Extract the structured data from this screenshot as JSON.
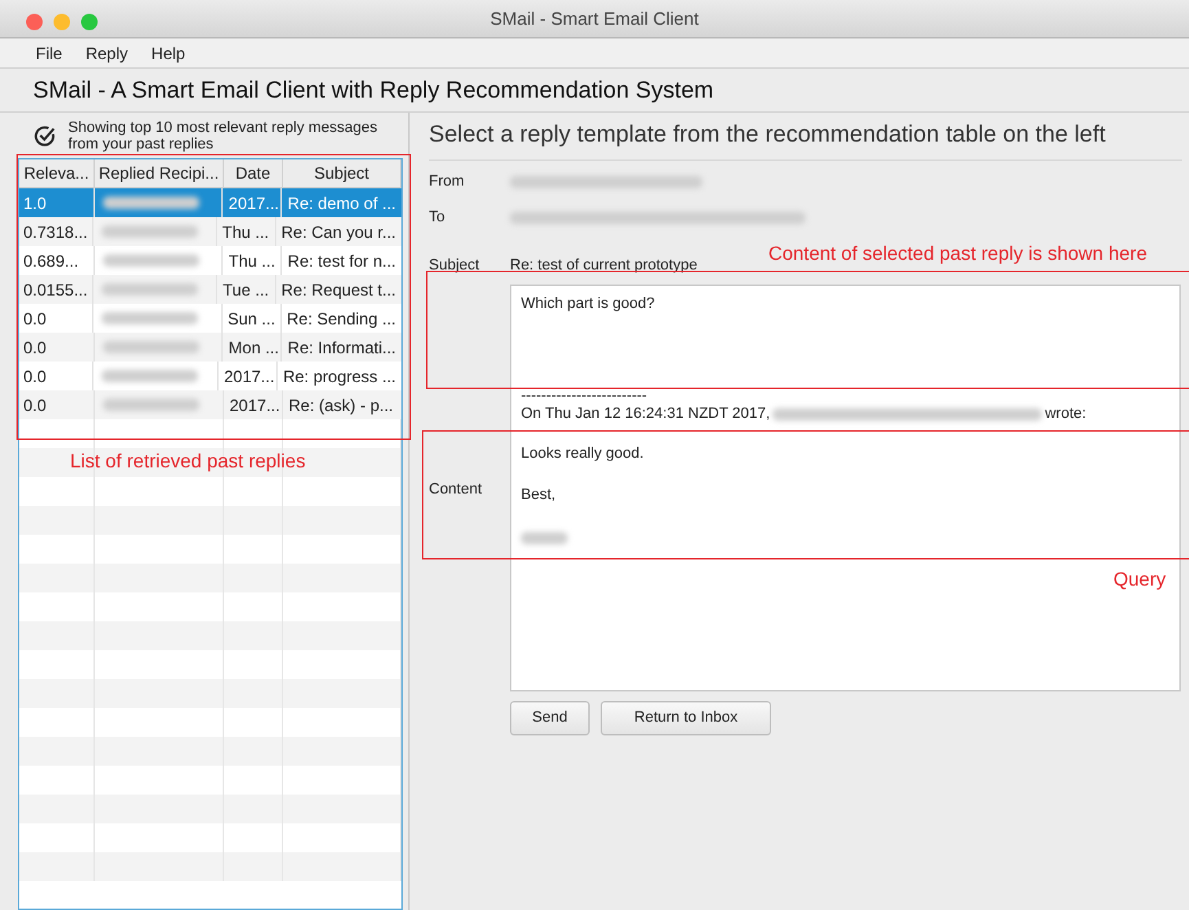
{
  "window": {
    "title": "SMail - Smart Email Client"
  },
  "menu": [
    "File",
    "Reply",
    "Help"
  ],
  "app_title": "SMail - A Smart Email Client with Reply Recommendation System",
  "left": {
    "notice": "Showing top 10 most relevant reply messages from your past replies",
    "table": {
      "columns": [
        "Releva...",
        "Replied Recipi...",
        "Date",
        "Subject"
      ],
      "rows": [
        {
          "relevance": "1.0",
          "date": "2017...",
          "subject": "Re: demo of ...",
          "selected": true
        },
        {
          "relevance": "0.7318...",
          "date": "Thu ...",
          "subject": "Re: Can you r...",
          "selected": false
        },
        {
          "relevance": "0.689...",
          "date": "Thu ...",
          "subject": "Re: test for n...",
          "selected": false
        },
        {
          "relevance": "0.0155...",
          "date": "Tue ...",
          "subject": "Re: Request t...",
          "selected": false
        },
        {
          "relevance": "0.0",
          "date": "Sun ...",
          "subject": "Re: Sending ...",
          "selected": false
        },
        {
          "relevance": "0.0",
          "date": "Mon ...",
          "subject": "Re: Informati...",
          "selected": false
        },
        {
          "relevance": "0.0",
          "date": "2017...",
          "subject": "Re: progress ...",
          "selected": false
        },
        {
          "relevance": "0.0",
          "date": "2017...",
          "subject": "Re: (ask) - p...",
          "selected": false
        }
      ]
    }
  },
  "right": {
    "heading": "Select a reply template from the recommendation table on the left",
    "from_label": "From",
    "to_label": "To",
    "subject_label": "Subject",
    "subject": "Re: test of current prototype",
    "content_label": "Content",
    "content": {
      "reply": "Which part is good?",
      "separator": "-------------------------",
      "quote_before": "On Thu Jan 12 16:24:31 NZDT 2017,",
      "quote_after": "wrote:",
      "paragraphs": [
        "Looks really good.",
        "Best,"
      ]
    },
    "buttons": [
      "Send",
      "Return to Inbox"
    ]
  },
  "annotations": [
    "List of retrieved past replies",
    "Content of selected past reply is shown here",
    "Query"
  ]
}
